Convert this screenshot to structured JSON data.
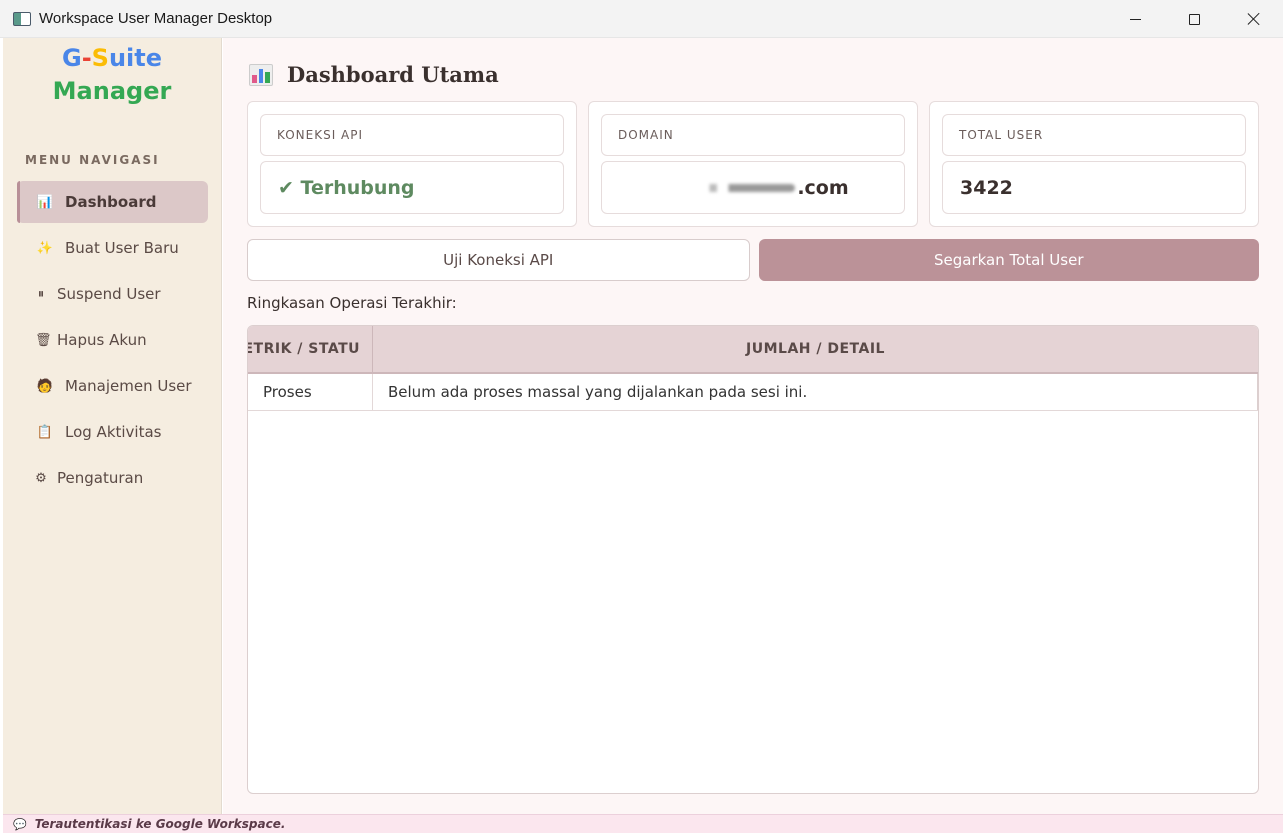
{
  "window": {
    "title": "Workspace User Manager Desktop"
  },
  "sidebar": {
    "brand": {
      "g": "G",
      "dash": "-",
      "s": "S",
      "uite": "uite",
      "line2": "Manager"
    },
    "nav_title": "MENU NAVIGASI",
    "items": [
      {
        "label": "Dashboard",
        "icon": "bar-chart-icon",
        "active": true
      },
      {
        "label": "Buat User Baru",
        "icon": "sparkles-icon"
      },
      {
        "label": "Suspend User",
        "icon": "pause-icon"
      },
      {
        "label": "Hapus Akun",
        "icon": "trash-icon"
      },
      {
        "label": "Manajemen User",
        "icon": "person-icon"
      },
      {
        "label": "Log Aktivitas",
        "icon": "clipboard-icon"
      },
      {
        "label": "Pengaturan",
        "icon": "gear-icon"
      }
    ]
  },
  "main": {
    "title": "Dashboard Utama",
    "cards": [
      {
        "label": "KONEKSI API",
        "value": "✔ Terhubung",
        "status_color": "#5e8a60"
      },
      {
        "label": "DOMAIN",
        "value": ".com"
      },
      {
        "label": "TOTAL USER",
        "value": "3422"
      }
    ],
    "buttons": {
      "test": "Uji Koneksi API",
      "refresh": "Segarkan Total User"
    },
    "summary_label": "Ringkasan Operasi Terakhir:",
    "table": {
      "headers": [
        "ETRIK / STATU",
        "JUMLAH / DETAIL"
      ],
      "rows": [
        [
          "Proses",
          "Belum ada proses massal yang dijalankan pada sesi ini."
        ]
      ]
    }
  },
  "status_bar": {
    "text": "Terautentikasi ke Google Workspace.",
    "icon": "speech-bubble-icon"
  },
  "colors": {
    "accent": "#bb9298",
    "sidebar_bg": "#f5ede0",
    "header_bg": "#e5d3d5"
  }
}
